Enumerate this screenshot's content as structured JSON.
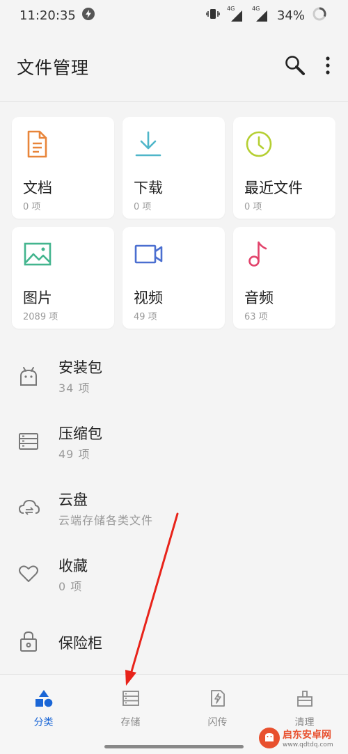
{
  "status": {
    "time": "11:20:35",
    "battery": "34%",
    "signal_label_1": "4G",
    "signal_label_2": "4G"
  },
  "header": {
    "title": "文件管理"
  },
  "categories": [
    {
      "name": "文档",
      "count": "0 项",
      "color": "#e8853a"
    },
    {
      "name": "下载",
      "count": "0 项",
      "color": "#4fb6c9"
    },
    {
      "name": "最近文件",
      "count": "0 项",
      "color": "#b5cf32"
    },
    {
      "name": "图片",
      "count": "2089 项",
      "color": "#43b58e"
    },
    {
      "name": "视频",
      "count": "49 项",
      "color": "#4a6ed0"
    },
    {
      "name": "音频",
      "count": "63 项",
      "color": "#e2436b"
    }
  ],
  "list": [
    {
      "title": "安装包",
      "sub": "34 项"
    },
    {
      "title": "压缩包",
      "sub": "49 项"
    },
    {
      "title": "云盘",
      "sub": "云端存储各类文件"
    },
    {
      "title": "收藏",
      "sub": "0 项"
    },
    {
      "title": "保险柜",
      "sub": ""
    }
  ],
  "nav": [
    {
      "label": "分类",
      "active": true
    },
    {
      "label": "存储",
      "active": false
    },
    {
      "label": "闪传",
      "active": false
    },
    {
      "label": "清理",
      "active": false
    }
  ],
  "watermark": {
    "name": "启东安卓网",
    "url": "www.qdtdq.com"
  },
  "colors": {
    "accent": "#1a66d6",
    "arrow": "#e8231a"
  }
}
